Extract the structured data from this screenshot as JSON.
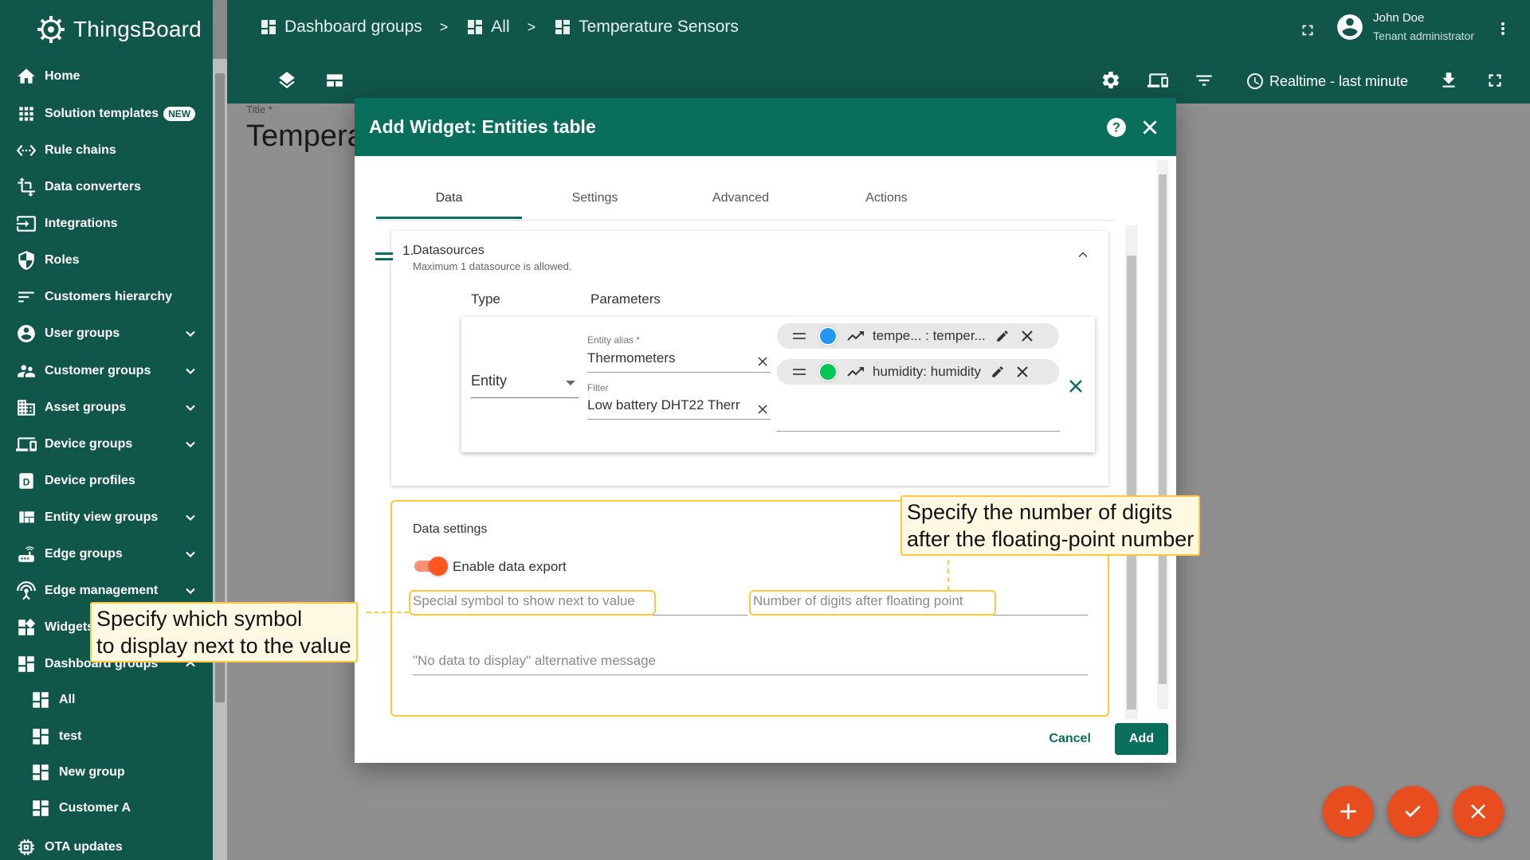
{
  "app": {
    "name": "ThingsBoard"
  },
  "colors": {
    "primary": "#11564b",
    "dialog_header": "#0a6e5d",
    "accent": "#ff5722",
    "highlight": "#ffc83d",
    "fab": "#e84d1f"
  },
  "sidebar": {
    "items": [
      {
        "label": "Home",
        "icon": "home-icon"
      },
      {
        "label": "Solution templates",
        "icon": "apps-icon",
        "badge": "NEW"
      },
      {
        "label": "Rule chains",
        "icon": "settings-ethernet-icon"
      },
      {
        "label": "Data converters",
        "icon": "transform-icon"
      },
      {
        "label": "Integrations",
        "icon": "input-icon"
      },
      {
        "label": "Roles",
        "icon": "shield-icon"
      },
      {
        "label": "Customers hierarchy",
        "icon": "sort-icon"
      },
      {
        "label": "User groups",
        "icon": "account-circle-icon"
      },
      {
        "label": "Customer groups",
        "icon": "supervisor-account-icon"
      },
      {
        "label": "Asset groups",
        "icon": "domain-icon"
      },
      {
        "label": "Device groups",
        "icon": "devices-icon"
      },
      {
        "label": "Device profiles",
        "icon": "device-profile-icon"
      },
      {
        "label": "Entity view groups",
        "icon": "view-quilt-icon"
      },
      {
        "label": "Edge groups",
        "icon": "router-icon"
      },
      {
        "label": "Edge management",
        "icon": "settings-input-antenna-icon"
      },
      {
        "label": "Widgets",
        "icon": "widgets-icon"
      },
      {
        "label": "Dashboard groups",
        "icon": "dashboard-icon"
      },
      {
        "label": "All",
        "icon": "dashboard-icon"
      },
      {
        "label": "test",
        "icon": "dashboard-icon"
      },
      {
        "label": "New group",
        "icon": "dashboard-icon"
      },
      {
        "label": "Customer A",
        "icon": "dashboard-icon"
      },
      {
        "label": "OTA updates",
        "icon": "memory-icon"
      }
    ]
  },
  "header": {
    "breadcrumbs": [
      "Dashboard groups",
      "All",
      "Temperature Sensors"
    ],
    "separator": ">",
    "user_name": "John Doe",
    "user_role": "Tenant administrator",
    "realtime": "Realtime - last minute"
  },
  "dashboard": {
    "title_label": "Title *",
    "title": "Tempera"
  },
  "dialog": {
    "title": "Add Widget: Entities table",
    "tabs": [
      "Data",
      "Settings",
      "Advanced",
      "Actions"
    ],
    "datasources": {
      "title": "Datasources",
      "subtitle": "Maximum 1 datasource is allowed.",
      "col_type": "Type",
      "col_params": "Parameters",
      "row_number": "1.",
      "type_value": "Entity",
      "entity_alias_label": "Entity alias *",
      "entity_alias_value": "Thermometers",
      "filter_label": "Filter",
      "filter_value": "Low battery DHT22 Therr",
      "keys": [
        {
          "label": "tempe... : temper...",
          "color": "#2196f3"
        },
        {
          "label": "humidity: humidity",
          "color": "#00c853"
        }
      ]
    },
    "data_settings": {
      "title": "Data settings",
      "export_label": "Enable data export",
      "units_placeholder": "Special symbol to show next to value",
      "decimals_placeholder": "Number of digits after floating point",
      "no_data_placeholder": "\"No data to display\" alternative message"
    },
    "cancel_label": "Cancel",
    "add_label": "Add"
  },
  "callouts": {
    "symbol": [
      "Specify which symbol",
      "to display next to the value"
    ],
    "digits": [
      "Specify the number of digits",
      "after the floating-point number"
    ]
  }
}
